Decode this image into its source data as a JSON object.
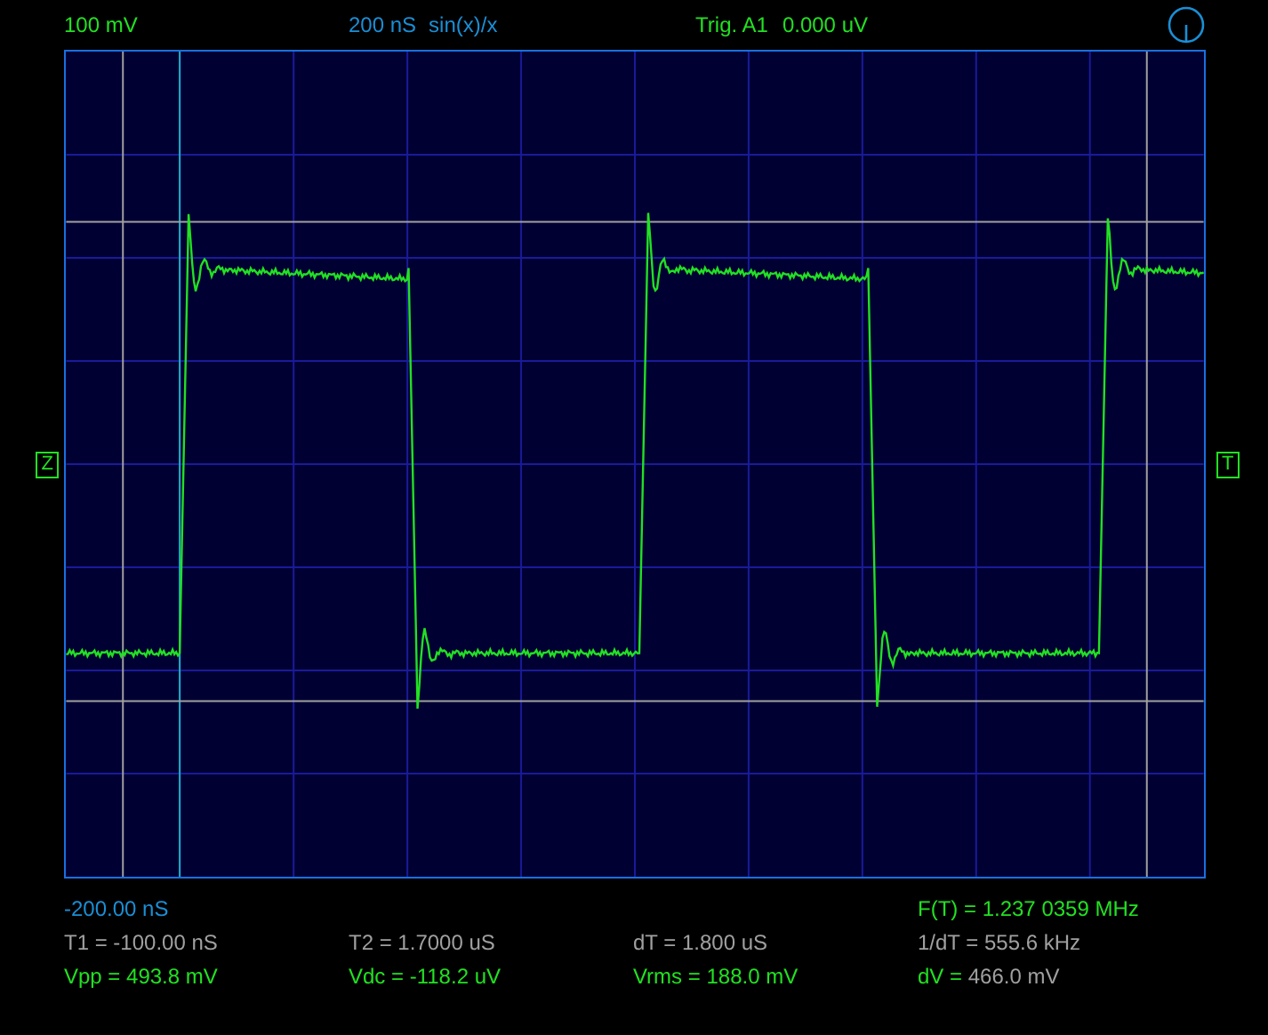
{
  "header": [
    {
      "text": "100 mV",
      "kind": "measure"
    },
    {
      "text": "200 nS",
      "kind": "time"
    },
    {
      "text": "sin(x)/x",
      "kind": "time"
    },
    {
      "text": "Trig. A1",
      "kind": "measure"
    },
    {
      "text": "0.000 uV",
      "kind": "measure"
    }
  ],
  "markers": {
    "left": "Z",
    "right": "T"
  },
  "readouts": [
    {
      "offset": {
        "parts": [
          {
            "text": "-200.00 nS",
            "kind": "time"
          }
        ]
      },
      "frequency": {
        "parts": [
          {
            "text": "F(T) = 1.237 0359 MHz",
            "kind": "measure"
          }
        ]
      }
    },
    [
      {
        "parts": [
          {
            "text": "T1 = -100.00 nS",
            "kind": "cursor"
          }
        ]
      },
      {
        "parts": [
          {
            "text": "T2 = 1.7000 uS",
            "kind": "cursor"
          }
        ]
      },
      {
        "parts": [
          {
            "text": "dT = 1.800 uS",
            "kind": "cursor"
          }
        ]
      },
      {
        "parts": [
          {
            "text": "1/dT = 555.6 kHz",
            "kind": "cursor"
          }
        ]
      }
    ],
    [
      {
        "parts": [
          {
            "text": "Vpp = 493.8 mV",
            "kind": "measure"
          }
        ]
      },
      {
        "parts": [
          {
            "text": "Vdc = -118.2 uV",
            "kind": "measure"
          }
        ]
      },
      {
        "parts": [
          {
            "text": "Vrms = 188.0 mV",
            "kind": "measure"
          }
        ]
      },
      {
        "parts": [
          {
            "text": "dV =",
            "kind": "measure"
          },
          {
            "text": " 466.0 mV",
            "kind": "cursor"
          }
        ]
      }
    ]
  ]
}
